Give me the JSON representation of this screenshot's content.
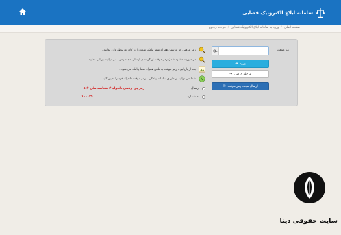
{
  "header": {
    "title": "سامانه ابلاغ الکترونیک قضایی"
  },
  "breadcrumb": {
    "items": [
      "صفحه اصلی",
      "ورود به سامانه ابلاغ الکترونیک قضایی",
      "مرحله ی دوم"
    ]
  },
  "form": {
    "password_label": "رمز موقت :",
    "password_value": "",
    "login_button": "ورود",
    "back_button": "مرحله ی قبل",
    "resend_button": "ارسال مجدد رمز موقت"
  },
  "info": {
    "rows": [
      {
        "icon": "search-key-icon",
        "text": "رمز موقتی که به تلفن همراه شما پیامک شده را در کادر مربوطه وارد نمایید ."
      },
      {
        "icon": "search-key-icon",
        "text": "در صورت مفقود شدن رمز موقت از گزینه ی ارسال مجدد رمز ، می توانید بازیابی نمایید."
      },
      {
        "icon": "image-icon",
        "text": "بعد از بازیابی ، رمز موقت به تلفن همراه شما پیامک می شود ."
      },
      {
        "icon": "globe-icon",
        "text": "شما می توانید از طریق سامانه پیامکی ، رمز موقت دلخواه خود را تعیین کنید."
      }
    ],
    "send_status_label": "ارسال",
    "send_status_value": "رمز پنج رقمی دلخواه # شناسه ملی # ۵",
    "number_label": "به شماره",
    "number_value": "۱۰۰۰۳۹"
  },
  "watermark": {
    "text": "سایت حقوقی دینا"
  },
  "colors": {
    "topbar": "#1a73c2",
    "login_button": "#2aaede",
    "resend_button": "#2c6fb5",
    "status_text": "#d32222"
  }
}
